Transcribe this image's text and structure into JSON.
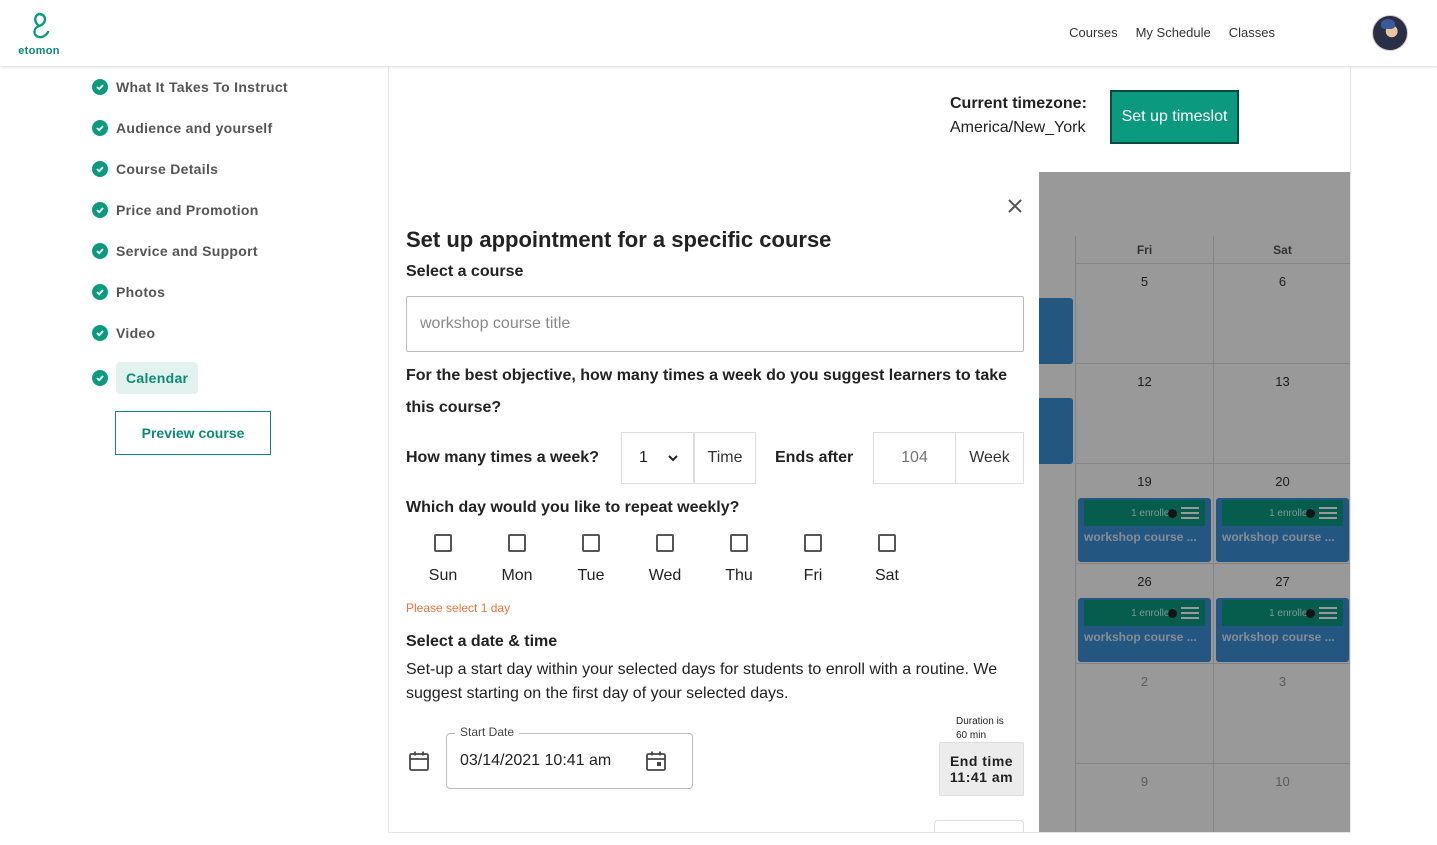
{
  "brand": {
    "name": "etomon",
    "color": "#0b9a80"
  },
  "nav": {
    "items": [
      "Courses",
      "My Schedule",
      "Classes"
    ]
  },
  "sidebar": {
    "steps": [
      {
        "label": "What It Takes To Instruct",
        "done": true
      },
      {
        "label": "Audience and yourself",
        "done": true
      },
      {
        "label": "Course Details",
        "done": true
      },
      {
        "label": "Price and Promotion",
        "done": true
      },
      {
        "label": "Service and Support",
        "done": true
      },
      {
        "label": "Photos",
        "done": true
      },
      {
        "label": "Video",
        "done": true
      },
      {
        "label": "Calendar",
        "done": true,
        "active": true
      }
    ],
    "preview_label": "Preview course"
  },
  "timezone": {
    "label": "Current timezone:",
    "value": "America/New_York"
  },
  "setup_button": "Set up timeslot",
  "calendar": {
    "days": [
      "Fri",
      "Sat"
    ],
    "weeks": [
      [
        "5",
        "6"
      ],
      [
        "12",
        "13"
      ],
      [
        "19",
        "20"
      ],
      [
        "26",
        "27"
      ],
      [
        "2",
        "3"
      ],
      [
        "9",
        "10"
      ]
    ],
    "event": {
      "enrolled": "1 enrolled",
      "title": "workshop course ..."
    }
  },
  "modal": {
    "title": "Set up appointment for a specific course",
    "select_course_label": "Select a course",
    "course_placeholder": "workshop course title",
    "question": "For the best objective, how many times a week do you suggest learners to take this course?",
    "times_label": "How many times a week?",
    "times_value": "1",
    "times_unit": "Time",
    "ends_label": "Ends after",
    "ends_placeholder": "104",
    "ends_unit": "Week",
    "repeat_label": "Which day would you like to repeat weekly?",
    "days": [
      "Sun",
      "Mon",
      "Tue",
      "Wed",
      "Thu",
      "Fri",
      "Sat"
    ],
    "warning": "Please select 1 day",
    "datetime_title": "Select a date & time",
    "datetime_desc": "Set-up a start day within your selected days for students to enroll with a routine. We suggest starting on the first day of your selected days.",
    "start_label": "Start Date",
    "start_value": "03/14/2021 10:41 am",
    "duration_line1": "Duration is",
    "duration_line2": "60 min",
    "end_line1": "End time",
    "end_line2": "11:41 am"
  }
}
